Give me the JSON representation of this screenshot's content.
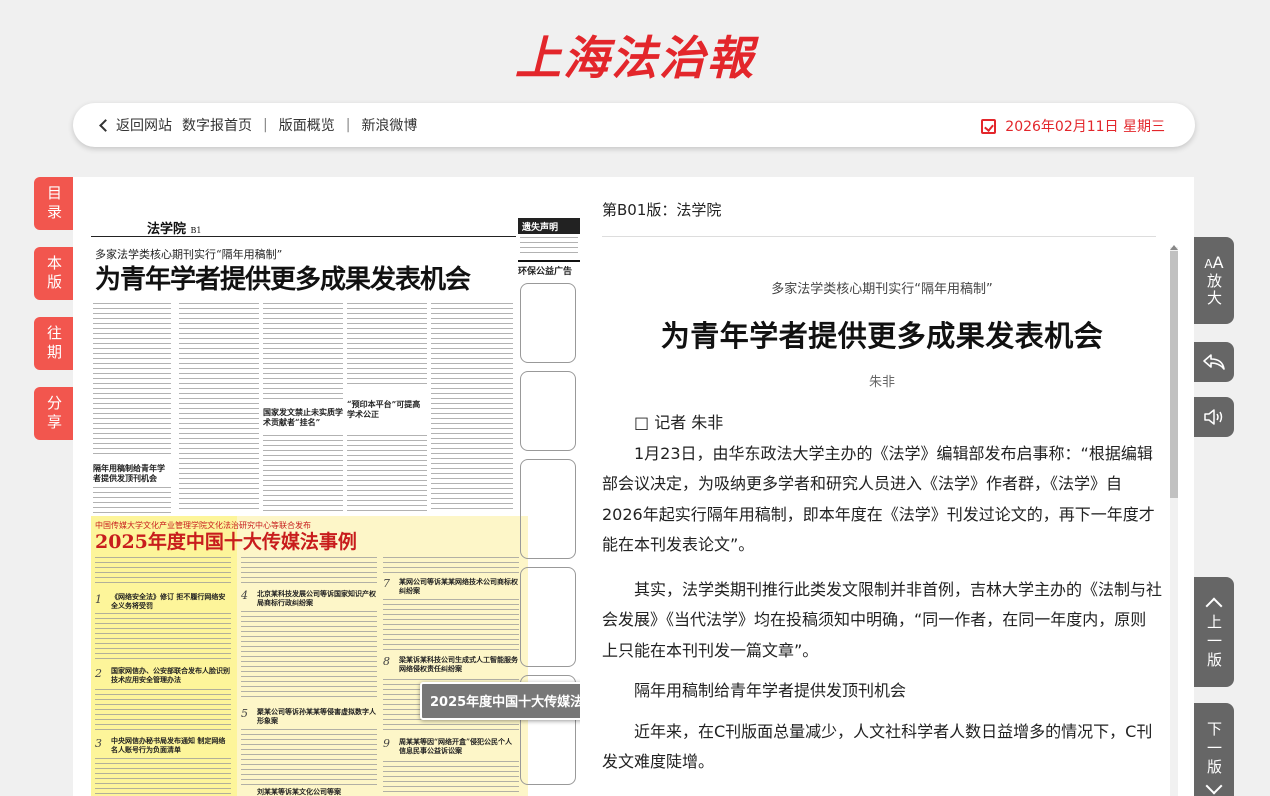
{
  "masthead": {
    "logo_text": "上海法治報"
  },
  "topbar": {
    "back_label": "返回网站",
    "links": [
      "数字报首页",
      "版面概览",
      "新浪微博"
    ],
    "separator": "|",
    "date": "2026年02月11日 星期三"
  },
  "left_tabs": [
    {
      "label": "目录"
    },
    {
      "label": "本版"
    },
    {
      "label": "往期"
    },
    {
      "label": "分享"
    }
  ],
  "newspaper_page": {
    "section": "法学院",
    "page_no": "B1",
    "kicker": "多家法学类核心期刊实行“隔年用稿制”",
    "headline": "为青年学者提供更多成果发表机会",
    "subheads": [
      "国家发文禁止未实质学术贡献者“挂名”",
      "“预印本平台”可提高学术公正",
      "隔年用稿制给青年学者提供发顶刊机会"
    ],
    "box_kicker": "中国传媒大学文化产业管理学院文化法治研究中心等联合发布",
    "box_headline": "2025年度中国十大传媒法事例",
    "box_items": [
      {
        "num": "1",
        "title": "《网络安全法》修订 拒不履行网络安全义务将受罚"
      },
      {
        "num": "2",
        "title": "国家网信办、公安部联合发布人脸识别技术应用安全管理办法"
      },
      {
        "num": "3",
        "title": "中央网信办秘书局发布通知 制定网络名人账号行为负面清单"
      },
      {
        "num": "4",
        "title": "北京某科技发展公司等诉国家知识产权局商标行政纠纷案"
      },
      {
        "num": "5",
        "title": "聚某公司等诉孙某某等侵害虚拟数字人形象案"
      },
      {
        "num": "6",
        "title": "刘某某等诉某文化公司等案"
      },
      {
        "num": "7",
        "title": "某网公司等诉某某网络技术公司商标权纠纷案"
      },
      {
        "num": "8",
        "title": "梁某诉某科技公司生成式人工智能服务网络侵权责任纠纷案"
      },
      {
        "num": "9",
        "title": "周某某等因“网络开盒”侵犯公民个人信息民事公益诉讼案"
      }
    ],
    "right_strip": {
      "top_box": "遗失声明",
      "heading": "环保公益广告"
    },
    "tooltip": "2025年度中国十大传媒法事例"
  },
  "article": {
    "header": "第B01版：法学院",
    "subtitle": "多家法学类核心期刊实行“隔年用稿制”",
    "title": "为青年学者提供更多成果发表机会",
    "author": "朱非",
    "paragraphs": [
      "□  记者  朱非",
      "1月23日，由华东政法大学主办的《法学》编辑部发布启事称：“根据编辑部会议决定，为吸纳更多学者和研究人员进入《法学》作者群，《法学》自2026年起实行隔年用稿制，即本年度在《法学》刊发过论文的，再下一年度才能在本刊发表论文”。",
      "其实，法学类期刊推行此类发文限制并非首例，吉林大学主办的《法制与社会发展》《当代法学》均在投稿须知中明确，“同一作者，在同一年度内，原则上只能在本刊刊发一篇文章”。",
      "隔年用稿制给青年学者提供发顶刊机会",
      "近年来，在C刊版面总量减少，人文社科学者人数日益增多的情况下，C刊发文难度陡增。"
    ]
  },
  "right_tools": {
    "zoom": {
      "icon_text": "AA",
      "label": "放大"
    },
    "back_icon": "reply-icon",
    "audio_icon": "speaker-icon",
    "prev_page": "上一版",
    "next_page": "下一版"
  },
  "colors": {
    "accent": "#e3262b",
    "tab_red": "#f2564e",
    "tool_gray": "#666666",
    "highlight": "#fdf59a"
  }
}
